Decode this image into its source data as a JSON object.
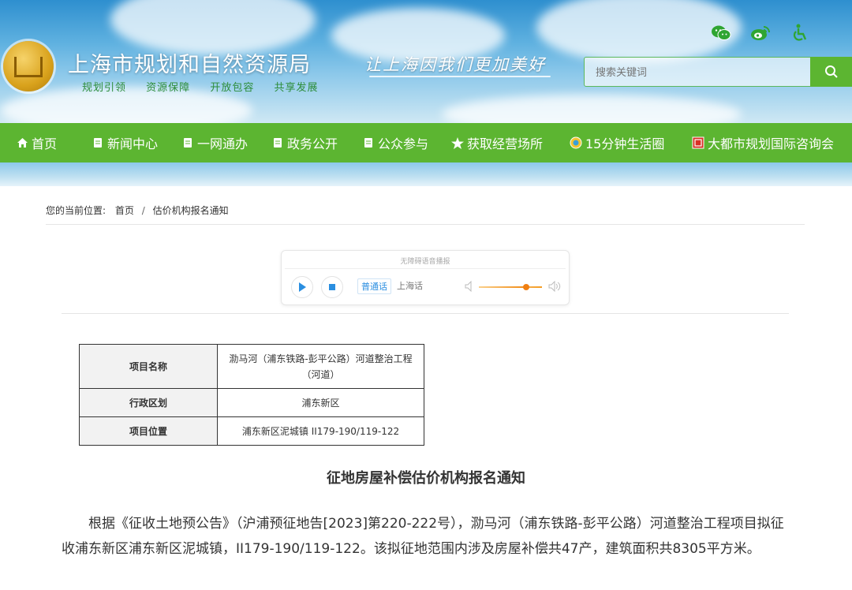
{
  "header": {
    "site_title": "上海市规划和自然资源局",
    "subtitle_items": [
      "规划引领",
      "资源保障",
      "开放包容",
      "共享发展"
    ],
    "slogan": "让上海因我们更加美好",
    "icons": [
      "wechat-icon",
      "weibo-icon",
      "accessibility-icon"
    ],
    "search_placeholder": "搜索关键词"
  },
  "nav": {
    "items": [
      {
        "label": "首页",
        "icon": "home-icon"
      },
      {
        "label": "新闻中心",
        "icon": "doc-icon"
      },
      {
        "label": "一网通办",
        "icon": "doc-icon"
      },
      {
        "label": "政务公开",
        "icon": "doc-icon"
      },
      {
        "label": "公众参与",
        "icon": "doc-icon"
      },
      {
        "label": "获取经营场所",
        "icon": "star-icon"
      },
      {
        "label": "15分钟生活圈",
        "icon": "globe-icon"
      },
      {
        "label": "大都市规划国际咨询会",
        "icon": "badge-icon"
      }
    ]
  },
  "breadcrumb": {
    "prefix": "您的当前位置:",
    "home": "首页",
    "separator": "/",
    "current": "估价机构报名通知"
  },
  "player": {
    "title": "无障碍语音播报",
    "lang_active": "普通话",
    "lang_other": "上海话",
    "volume_level": 0.75
  },
  "info_table": {
    "rows": [
      {
        "label": "项目名称",
        "value": "泐马河（浦东铁路-彭平公路）河道整治工程（河道）"
      },
      {
        "label": "行政区划",
        "value": "浦东新区"
      },
      {
        "label": "项目位置",
        "value": "浦东新区泥城镇 II179-190/119-122"
      }
    ]
  },
  "notice": {
    "title": "征地房屋补偿估价机构报名通知",
    "body": "根据《征收土地预公告》（沪浦预征地告[2023]第220-222号），泐马河（浦东铁路-彭平公路）河道整治工程项目拟征收浦东新区浦东新区泥城镇，II179-190/119-122。该拟征地范围内涉及房屋补偿共47产，建筑面积共8305平方米。"
  },
  "colors": {
    "nav_green": "#5cb531",
    "accent_orange": "#f07f12",
    "link_blue": "#2a8ee0"
  }
}
